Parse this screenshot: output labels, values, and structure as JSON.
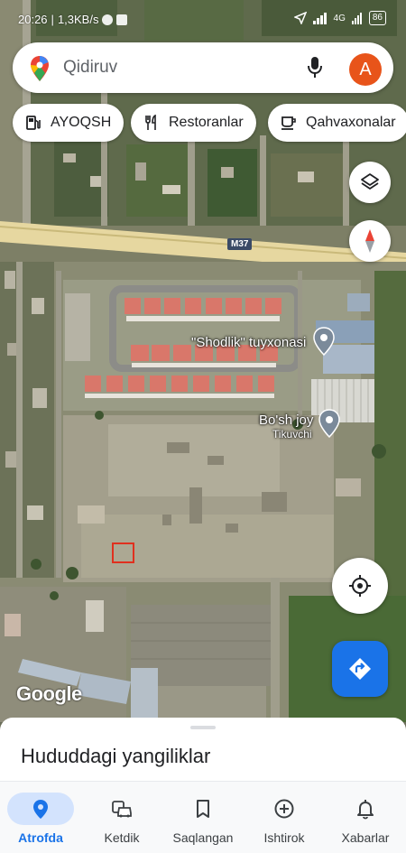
{
  "status_bar": {
    "time": "20:26",
    "speed": "1,3KB/s",
    "network": "4G",
    "battery": "86"
  },
  "search": {
    "placeholder": "Qidiruv",
    "avatar_letter": "A"
  },
  "chips": [
    {
      "label": "AYOQSH",
      "icon": "gas-station-icon"
    },
    {
      "label": "Restoranlar",
      "icon": "fork-knife-icon"
    },
    {
      "label": "Qahvaxonalar",
      "icon": "coffee-cup-icon"
    }
  ],
  "map": {
    "road_shield": "M37",
    "places": [
      {
        "name": "\"Shodlik\" tuyxonasi",
        "category": ""
      },
      {
        "name": "Bo'sh joy",
        "category": "Tikuvchi"
      }
    ],
    "attribution": "Google"
  },
  "sheet": {
    "title": "Hududdagi yangiliklar"
  },
  "nav": [
    {
      "label": "Atrofda",
      "icon": "location-pin-icon",
      "active": true
    },
    {
      "label": "Ketdik",
      "icon": "commute-icon",
      "active": false
    },
    {
      "label": "Saqlangan",
      "icon": "bookmark-icon",
      "active": false
    },
    {
      "label": "Ishtirok",
      "icon": "add-circle-icon",
      "active": false
    },
    {
      "label": "Xabarlar",
      "icon": "bell-icon",
      "active": false
    }
  ],
  "colors": {
    "accent": "#1a73e8",
    "avatar": "#e8541a",
    "highway": "#e8d9a0"
  }
}
